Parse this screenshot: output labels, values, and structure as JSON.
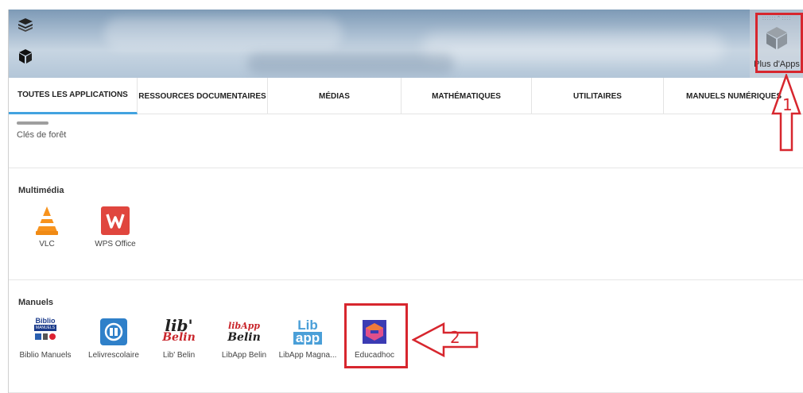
{
  "more_apps": {
    "label": "Plus d'Apps",
    "icon": "cube-icon",
    "grip": "::::::⌃::::"
  },
  "side_icons": [
    "layers-icon",
    "cube-icon"
  ],
  "tabs": [
    {
      "label": "TOUTES LES APPLICATIONS",
      "active": true
    },
    {
      "label": "RESSOURCES DOCUMENTAIRES",
      "active": false
    },
    {
      "label": "MÉDIAS",
      "active": false
    },
    {
      "label": "MATHÉMATIQUES",
      "active": false
    },
    {
      "label": "UTILITAIRES",
      "active": false
    },
    {
      "label": "MANUELS NUMÉRIQUES",
      "active": false
    }
  ],
  "sections": {
    "cut": {
      "app_label": "Clés de forêt"
    },
    "multimedia": {
      "title": "Multimédia",
      "apps": [
        {
          "label": "VLC"
        },
        {
          "label": "WPS Office"
        }
      ]
    },
    "manuels": {
      "title": "Manuels",
      "apps": [
        {
          "label": "Biblio Manuels"
        },
        {
          "label": "Lelivrescolaire"
        },
        {
          "label": "Lib' Belin"
        },
        {
          "label": "LibApp Belin"
        },
        {
          "label": "LibApp Magna..."
        },
        {
          "label": "Éducadhoc"
        }
      ]
    }
  },
  "icon_text": {
    "biblio_top": "Biblio",
    "biblio_sub": "MANUELS",
    "libbelin_lib": "lib'",
    "libbelin_belin": "Belin",
    "libapp_libapp": "libApp",
    "libapp_belin": "Belin",
    "magnard_lib": "Lib",
    "magnard_app": "app"
  },
  "annotations": {
    "num1": "1",
    "num2": "2"
  },
  "colors": {
    "tab_active": "#42a3e0",
    "annotation": "#d7262e",
    "wps": "#e0463e",
    "vlc": "#f7931e",
    "educadhoc": "#3b3bb3"
  }
}
